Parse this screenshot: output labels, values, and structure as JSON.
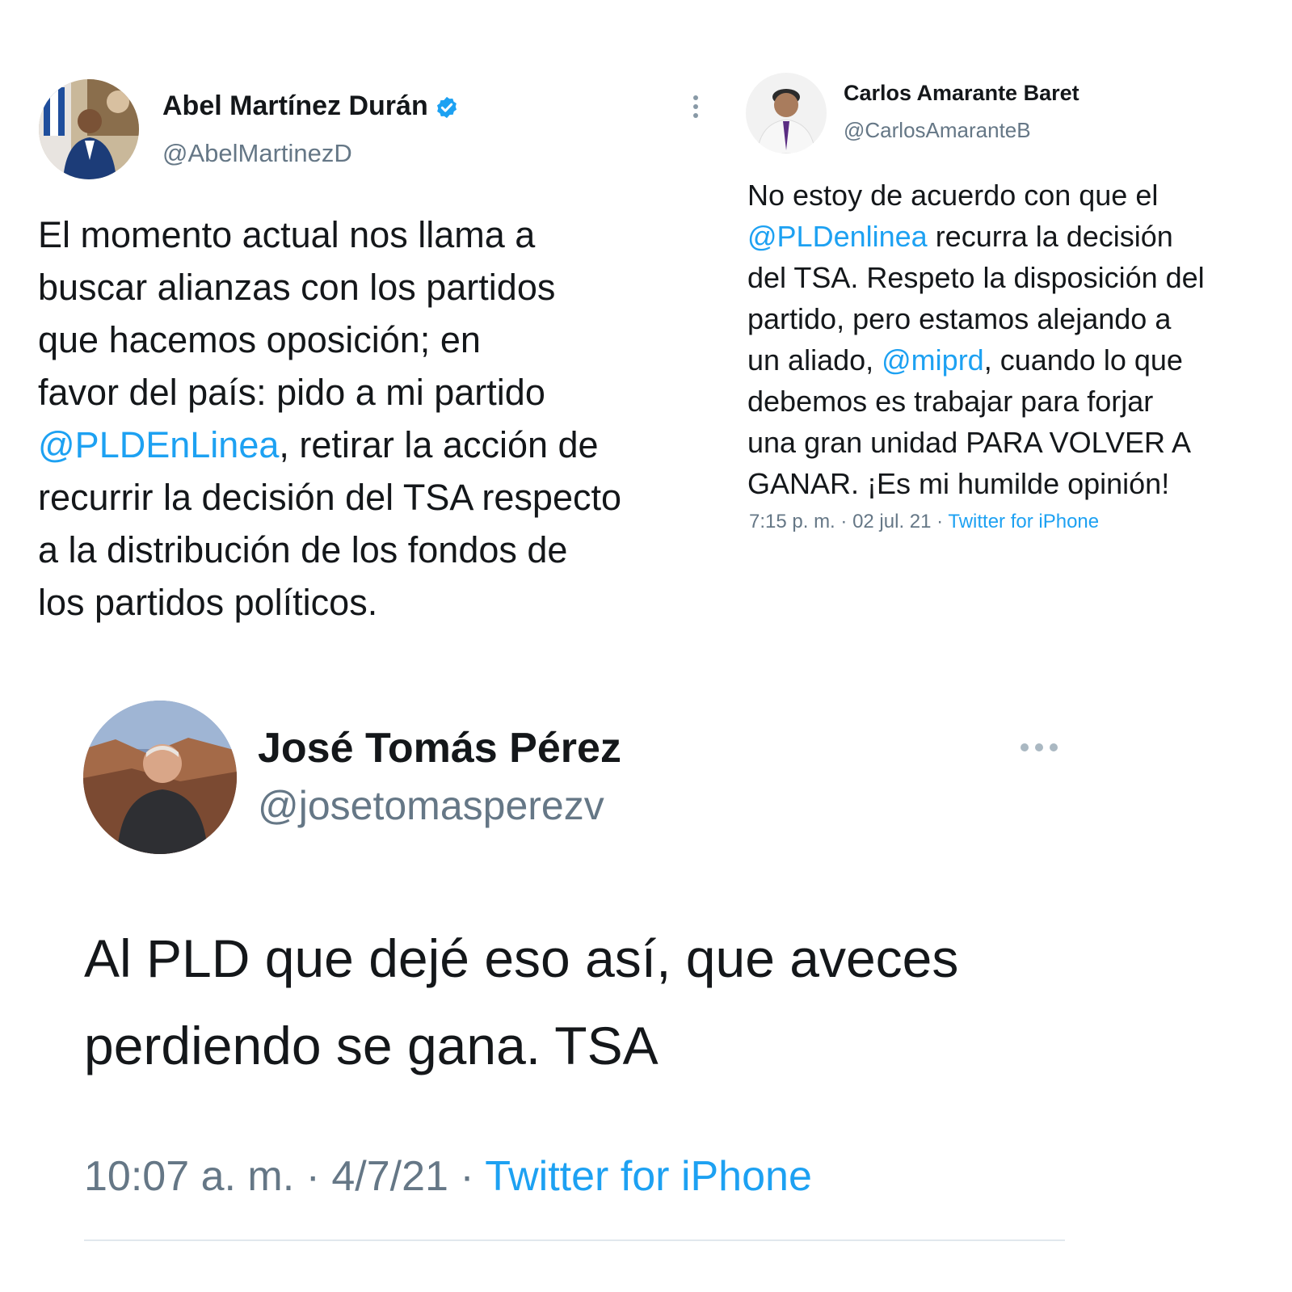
{
  "tweets": [
    {
      "name": "Abel Martínez Durán",
      "handle": "@AbelMartinezD",
      "verified": true,
      "body": [
        {
          "text": "El momento actual nos llama a\nbuscar alianzas con los partidos\nque hacemos oposición; en\nfavor del país: pido a mi partido\n",
          "mention": false
        },
        {
          "text": "@PLDEnLinea",
          "mention": true
        },
        {
          "text": ", retirar la acción de\nrecurrir la decisión del TSA respecto\na la distribución de los fondos de\nlos partidos políticos.",
          "mention": false
        }
      ]
    },
    {
      "name": "Carlos Amarante Baret",
      "handle": "@CarlosAmaranteB",
      "body": [
        {
          "text": "No estoy de acuerdo con que el\n",
          "mention": false
        },
        {
          "text": "@PLDenlinea",
          "mention": true
        },
        {
          "text": " recurra la decisión\ndel TSA. Respeto la disposición del\npartido, pero estamos alejando a\nun aliado, ",
          "mention": false
        },
        {
          "text": "@miprd",
          "mention": true
        },
        {
          "text": ", cuando lo que\ndebemos es trabajar para forjar\nuna gran unidad PARA VOLVER A\nGANAR. ¡Es mi humilde opinión!",
          "mention": false
        }
      ],
      "time": "7:15 p. m.",
      "date": "02 jul. 21",
      "source": "Twitter for iPhone"
    },
    {
      "name": "José Tomás Pérez",
      "handle": "@josetomasperezv",
      "body": [
        {
          "text": "Al PLD que dejé eso así, que aveces\nperdiendo se gana. TSA",
          "mention": false
        }
      ],
      "time": "10:07 a. m.",
      "date": "4/7/21",
      "source": "Twitter for iPhone"
    }
  ],
  "colors": {
    "mention": "#1da1f2",
    "muted": "#657786",
    "verified": "#1da1f2"
  },
  "icons": {
    "verified": "verified-badge-icon",
    "more_vertical": "more-vertical-icon",
    "more_horizontal": "more-horizontal-icon"
  }
}
